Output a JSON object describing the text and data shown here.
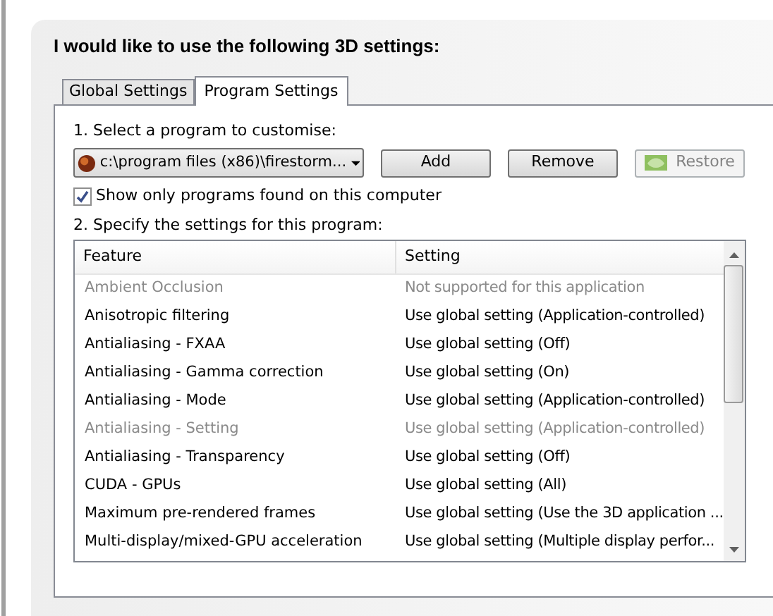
{
  "heading": "I would like to use the following 3D settings:",
  "tabs": [
    {
      "label": "Global Settings",
      "selected": false
    },
    {
      "label": "Program Settings",
      "selected": true
    }
  ],
  "step1_label": "1. Select a program to customise:",
  "program_select": {
    "value": "c:\\program files (x86)\\firestorm..."
  },
  "buttons": [
    {
      "label": "Add",
      "disabled": false,
      "kind": "plain"
    },
    {
      "label": "Remove",
      "disabled": false,
      "kind": "plain"
    },
    {
      "label": "Restore",
      "disabled": true,
      "kind": "logo"
    }
  ],
  "show_only_found": {
    "label": "Show only programs found on this computer",
    "checked": true
  },
  "step2_label": "2. Specify the settings for this program:",
  "table": {
    "columns": [
      "Feature",
      "Setting"
    ],
    "rows": [
      {
        "feature": "Ambient Occlusion",
        "setting": "Not supported for this application",
        "disabled": true
      },
      {
        "feature": "Anisotropic filtering",
        "setting": "Use global setting (Application-controlled)",
        "disabled": false
      },
      {
        "feature": "Antialiasing - FXAA",
        "setting": "Use global setting (Off)",
        "disabled": false
      },
      {
        "feature": "Antialiasing - Gamma correction",
        "setting": "Use global setting (On)",
        "disabled": false
      },
      {
        "feature": "Antialiasing - Mode",
        "setting": "Use global setting (Application-controlled)",
        "disabled": false
      },
      {
        "feature": "Antialiasing - Setting",
        "setting": "Use global setting (Application-controlled)",
        "disabled": true
      },
      {
        "feature": "Antialiasing - Transparency",
        "setting": "Use global setting (Off)",
        "disabled": false
      },
      {
        "feature": "CUDA - GPUs",
        "setting": "Use global setting (All)",
        "disabled": false
      },
      {
        "feature": "Maximum pre-rendered frames",
        "setting": "Use global setting (Use the 3D application ...",
        "disabled": false
      },
      {
        "feature": "Multi-display/mixed-GPU acceleration",
        "setting": "Use global setting (Multiple display perfor...",
        "disabled": false
      }
    ]
  }
}
